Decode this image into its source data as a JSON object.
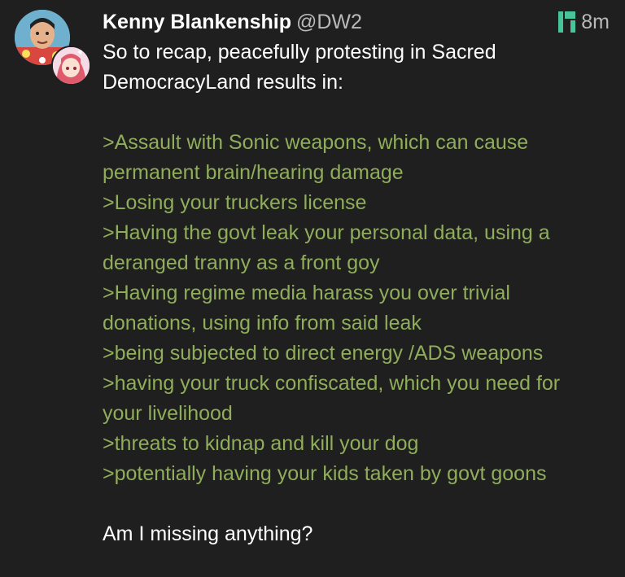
{
  "post": {
    "author": {
      "display_name": "Kenny Blankenship",
      "handle": "@DW2"
    },
    "timestamp": "8m",
    "client_icon": "pleroma-icon",
    "accent_color": "#47c49a",
    "greentext_color": "#8fad5a",
    "intro_lines": [
      "So to recap, peacefully protesting in Sacred",
      "DemocracyLand results in:"
    ],
    "greentext_lines": [
      ">Assault with Sonic weapons, which can cause",
      "permanent brain/hearing damage",
      ">Losing your truckers license",
      ">Having the govt leak your personal data, using a",
      "deranged tranny as a front goy",
      ">Having regime media harass you over trivial",
      "donations, using info from said leak",
      ">being subjected to direct energy /ADS weapons",
      ">having your truck confiscated, which you need for",
      "your livelihood",
      ">threats to kidnap and kill your dog",
      ">potentially having your kids taken by govt goons"
    ],
    "closing": "Am I missing anything?"
  }
}
